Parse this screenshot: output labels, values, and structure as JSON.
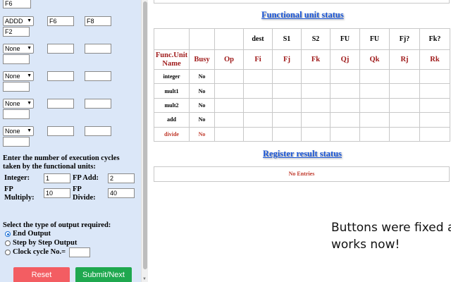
{
  "left_panel": {
    "instr_rows": [
      {
        "op": "F6",
        "op_type": "input",
        "src1": "",
        "src2": "",
        "dest": "",
        "show_src": false
      },
      {
        "op": "ADDD",
        "op_type": "select",
        "src1": "F6",
        "src2": "F8",
        "dest": "F2",
        "show_src": true
      },
      {
        "op": "None",
        "op_type": "select",
        "src1": "",
        "src2": "",
        "dest": "",
        "show_src": true
      },
      {
        "op": "None",
        "op_type": "select",
        "src1": "",
        "src2": "",
        "dest": "",
        "show_src": true
      },
      {
        "op": "None",
        "op_type": "select",
        "src1": "",
        "src2": "",
        "dest": "",
        "show_src": true
      },
      {
        "op": "None",
        "op_type": "select",
        "src1": "",
        "src2": "",
        "dest": "",
        "show_src": true
      }
    ],
    "cycles_heading_line1": "Enter the number of execution cycles",
    "cycles_heading_line2": "taken by the functional units:",
    "integer_label": "Integer:",
    "integer_value": "1",
    "fp_add_label": "FP Add:",
    "fp_add_value": "2",
    "fp_multiply_label_1": "FP",
    "fp_multiply_label_2": "Multiply:",
    "fp_multiply_value": "10",
    "fp_divide_label_1": "FP",
    "fp_divide_label_2": "Divide:",
    "fp_divide_value": "40",
    "output_heading": "Select the type of output required:",
    "output_options": [
      {
        "label": "End Output",
        "selected": true
      },
      {
        "label": "Step by Step Output",
        "selected": false
      },
      {
        "label": "Clock cycle No.=",
        "selected": false
      }
    ],
    "clock_cycle_value": "",
    "reset_label": "Reset",
    "reset_color": "#f35d62",
    "submit_label": "Submit/Next",
    "submit_color": "#1fa84f"
  },
  "right_panel": {
    "fu_title": "Functional unit status",
    "header_row1": [
      "",
      "",
      "",
      "dest",
      "S1",
      "S2",
      "FU",
      "FU",
      "Fj?",
      "Fk?"
    ],
    "header_row2": [
      "Func.Unit Name",
      "Busy",
      "Op",
      "Fi",
      "Fj",
      "Fk",
      "Qj",
      "Qk",
      "Rj",
      "Rk"
    ],
    "units": [
      {
        "name": "integer",
        "busy": "No",
        "highlight": false
      },
      {
        "name": "mult1",
        "busy": "No",
        "highlight": false
      },
      {
        "name": "mult2",
        "busy": "No",
        "highlight": false
      },
      {
        "name": "add",
        "busy": "No",
        "highlight": false
      },
      {
        "name": "divide",
        "busy": "No",
        "highlight": true
      }
    ],
    "reg_title": "Register result status",
    "reg_empty": "No Entries",
    "note_line1": "Buttons were fixed and",
    "note_line2": "works now!"
  }
}
